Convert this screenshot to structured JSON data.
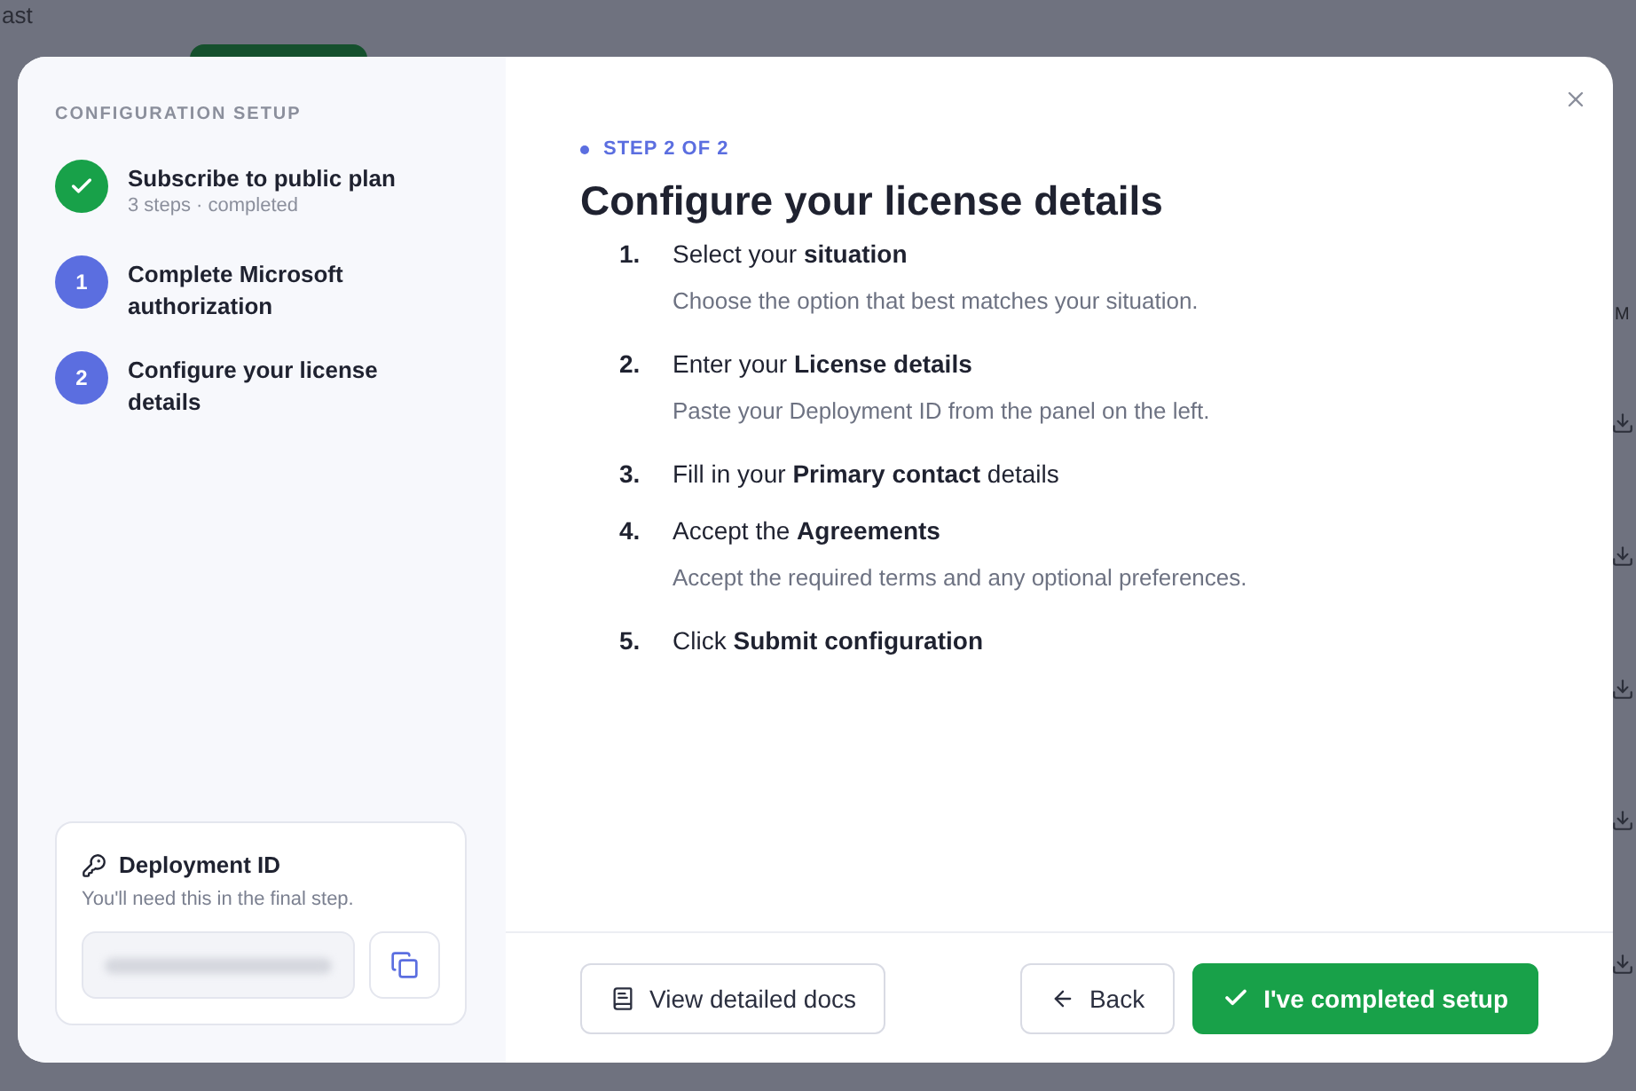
{
  "backdrop": {
    "top_text": "ast",
    "column_text": "M"
  },
  "sidebar": {
    "heading": "CONFIGURATION SETUP",
    "steps": [
      {
        "kind": "done",
        "title": "Subscribe to public plan",
        "subtitle": "3 steps · completed"
      },
      {
        "kind": "number",
        "marker": "1",
        "title": "Complete Microsoft authorization"
      },
      {
        "kind": "number",
        "marker": "2",
        "title": "Configure your license details"
      }
    ],
    "deployment": {
      "title": "Deployment ID",
      "hint": "You'll need this in the final step."
    }
  },
  "main": {
    "eyebrow": "STEP 2 OF 2",
    "title": "Configure your license details",
    "steps": [
      {
        "number": "1.",
        "text": "Select your **situation**",
        "detail": "Choose the option that best matches your situation."
      },
      {
        "number": "2.",
        "text": "Enter your **License details**",
        "detail": "Paste your Deployment ID from the panel on the left."
      },
      {
        "number": "3.",
        "text": "Fill in your **Primary contact** details"
      },
      {
        "number": "4.",
        "text": "Accept the **Agreements**",
        "detail": "Accept the required terms and any optional preferences."
      },
      {
        "number": "5.",
        "text": "Click **Submit configuration**"
      }
    ]
  },
  "footer": {
    "docs": "View detailed docs",
    "back": "Back",
    "done": "I've completed setup"
  }
}
